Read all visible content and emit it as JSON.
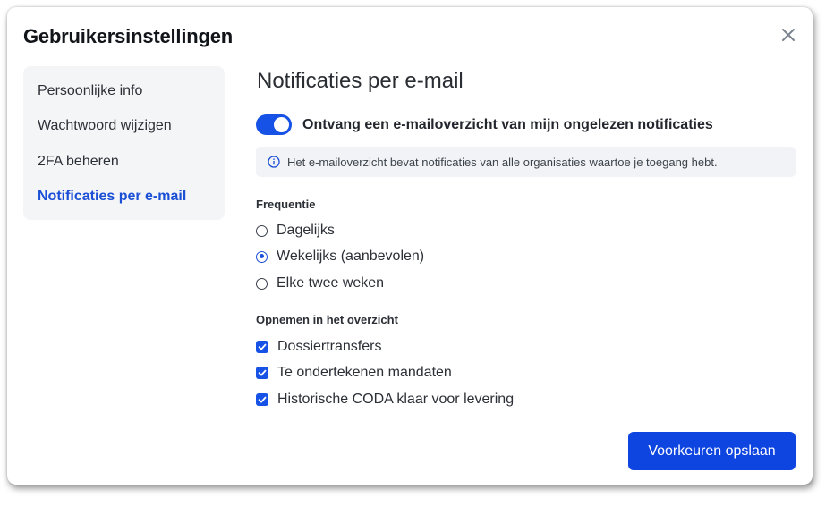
{
  "modal": {
    "title": "Gebruikersinstellingen"
  },
  "sidebar": {
    "items": [
      {
        "label": "Persoonlijke info",
        "active": false
      },
      {
        "label": "Wachtwoord wijzigen",
        "active": false
      },
      {
        "label": "2FA beheren",
        "active": false
      },
      {
        "label": "Notificaties per e-mail",
        "active": true
      }
    ]
  },
  "main": {
    "title": "Notificaties per e-mail",
    "toggle": {
      "label": "Ontvang een e-mailoverzicht van mijn ongelezen notificaties",
      "on": true
    },
    "info": {
      "icon": "info-icon",
      "text": "Het e-mailoverzicht bevat notificaties van alle organisaties waartoe je toegang hebt."
    },
    "frequency": {
      "label": "Frequentie",
      "options": [
        {
          "label": "Dagelijks",
          "selected": false
        },
        {
          "label": "Wekelijks (aanbevolen)",
          "selected": true
        },
        {
          "label": "Elke twee weken",
          "selected": false
        }
      ]
    },
    "include": {
      "label": "Opnemen in het overzicht",
      "options": [
        {
          "label": "Dossiertransfers",
          "checked": true
        },
        {
          "label": "Te ondertekenen mandaten",
          "checked": true
        },
        {
          "label": "Historische CODA klaar voor levering",
          "checked": true
        }
      ]
    },
    "save_label": "Voorkeuren opslaan"
  },
  "colors": {
    "accent": "#1652e6",
    "active_nav": "#1a4fd6",
    "sidebar_bg": "#f4f5f7",
    "info_bg": "#f1f3f6"
  }
}
